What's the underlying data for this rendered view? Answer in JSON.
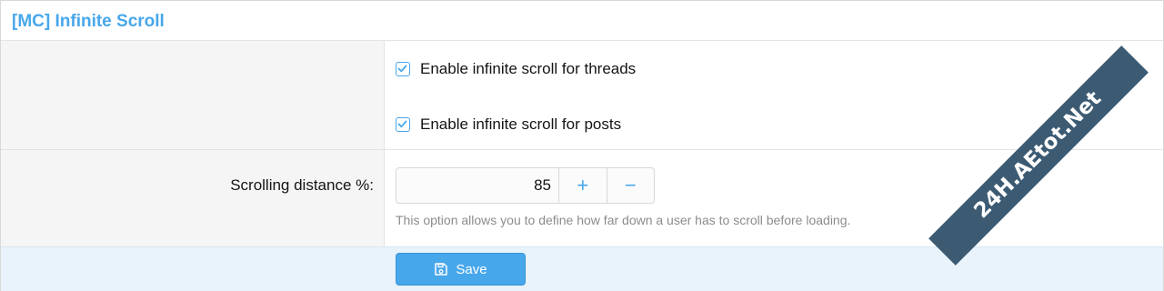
{
  "header": {
    "title": "[MC] Infinite Scroll"
  },
  "options": [
    {
      "label": "Enable infinite scroll for threads",
      "checked": true
    },
    {
      "label": "Enable infinite scroll for posts",
      "checked": true
    }
  ],
  "scrolling": {
    "label": "Scrolling distance %:",
    "value": "85",
    "increment_symbol": "+",
    "decrement_symbol": "−",
    "hint": "This option allows you to define how far down a user has to scroll before loading."
  },
  "footer": {
    "save_label": "Save",
    "save_icon": "save-icon"
  },
  "watermark": {
    "text": "24H.AEtot.Net"
  },
  "colors": {
    "accent": "#47a7eb",
    "footer_bg": "#e9f3fb",
    "left_col_bg": "#f5f5f5"
  }
}
